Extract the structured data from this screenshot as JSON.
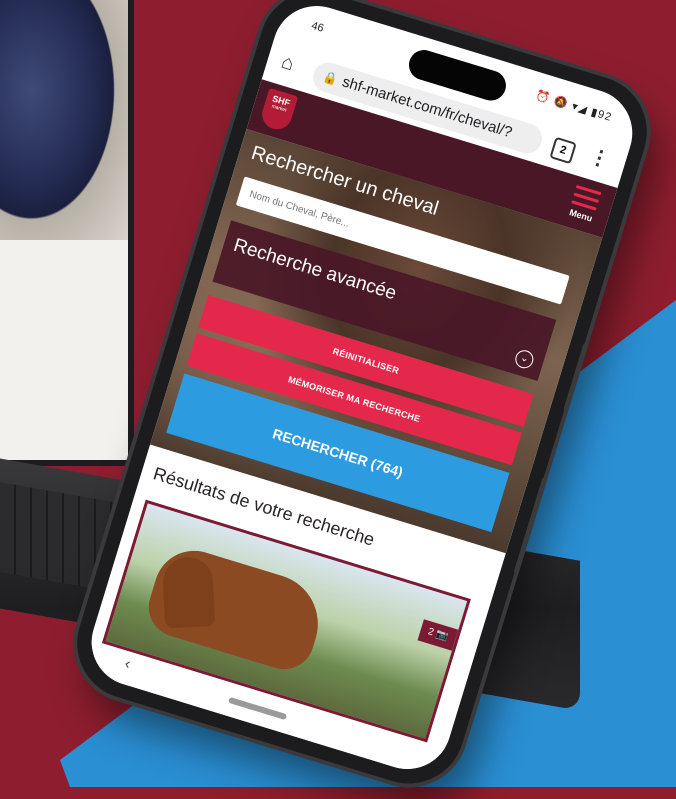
{
  "browser": {
    "time": "46",
    "status_icons": "⏰ 🔕 ▾◢ ▮92",
    "url": "shf-market.com/fr/cheval/?",
    "tab_count": "2"
  },
  "site": {
    "logo_text": "SHF",
    "logo_subtext": "market",
    "menu_label": "Menu"
  },
  "search": {
    "title": "Rechercher un cheval",
    "placeholder": "Nom du Cheval, Père...",
    "advanced_label": "Recherche avancée",
    "reset_label": "RÉINITIALISER",
    "save_label": "MÉMORISER MA RECHERCHE",
    "search_label": "RECHERCHER (764)"
  },
  "results": {
    "title": "Résultats de votre recherche",
    "photo_count": "2"
  },
  "colors": {
    "brand_red": "#e4284b",
    "brand_dark": "#4a1727",
    "brand_blue": "#2d9bdf",
    "background_red": "#8e1e2f"
  },
  "icons": {
    "home": "home-icon",
    "lock": "lock-icon",
    "kebab": "more-vert-icon",
    "camera": "camera-icon",
    "chevron": "chevron-down-icon",
    "back": "back-icon"
  }
}
